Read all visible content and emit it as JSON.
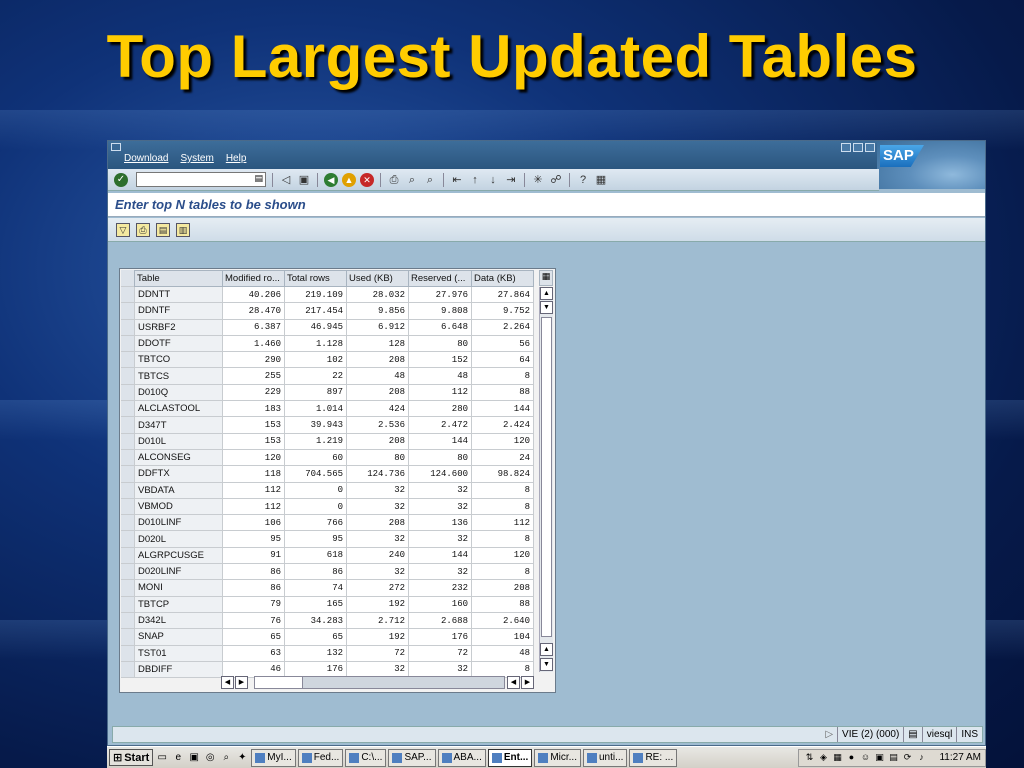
{
  "slide": {
    "title": "Top Largest Updated Tables"
  },
  "menu": {
    "items": [
      "Download",
      "System",
      "Help"
    ]
  },
  "sap": {
    "logo": "SAP"
  },
  "screen": {
    "title": "Enter top N tables to be shown"
  },
  "grid": {
    "columns": [
      "Table",
      "Modified ro...",
      "Total rows",
      "Used (KB)",
      "Reserved (...",
      "Data (KB)"
    ],
    "rows": [
      [
        "DDNTT",
        "40.206",
        "219.109",
        "28.032",
        "27.976",
        "27.864"
      ],
      [
        "DDNTF",
        "28.470",
        "217.454",
        "9.856",
        "9.808",
        "9.752"
      ],
      [
        "USRBF2",
        "6.387",
        "46.945",
        "6.912",
        "6.648",
        "2.264"
      ],
      [
        "DDOTF",
        "1.460",
        "1.128",
        "128",
        "80",
        "56"
      ],
      [
        "TBTCO",
        "290",
        "102",
        "208",
        "152",
        "64"
      ],
      [
        "TBTCS",
        "255",
        "22",
        "48",
        "48",
        "8"
      ],
      [
        "D010Q",
        "229",
        "897",
        "208",
        "112",
        "88"
      ],
      [
        "ALCLASTOOL",
        "183",
        "1.014",
        "424",
        "280",
        "144"
      ],
      [
        "D347T",
        "153",
        "39.943",
        "2.536",
        "2.472",
        "2.424"
      ],
      [
        "D010L",
        "153",
        "1.219",
        "208",
        "144",
        "120"
      ],
      [
        "ALCONSEG",
        "120",
        "60",
        "80",
        "80",
        "24"
      ],
      [
        "DDFTX",
        "118",
        "704.565",
        "124.736",
        "124.600",
        "98.824"
      ],
      [
        "VBDATA",
        "112",
        "0",
        "32",
        "32",
        "8"
      ],
      [
        "VBMOD",
        "112",
        "0",
        "32",
        "32",
        "8"
      ],
      [
        "D010LINF",
        "106",
        "766",
        "208",
        "136",
        "112"
      ],
      [
        "D020L",
        "95",
        "95",
        "32",
        "32",
        "8"
      ],
      [
        "ALGRPCUSGE",
        "91",
        "618",
        "240",
        "144",
        "120"
      ],
      [
        "D020LINF",
        "86",
        "86",
        "32",
        "32",
        "8"
      ],
      [
        "MONI",
        "86",
        "74",
        "272",
        "232",
        "208"
      ],
      [
        "TBTCP",
        "79",
        "165",
        "192",
        "160",
        "88"
      ],
      [
        "D342L",
        "76",
        "34.283",
        "2.712",
        "2.688",
        "2.640"
      ],
      [
        "SNAP",
        "65",
        "65",
        "192",
        "176",
        "104"
      ],
      [
        "TST01",
        "63",
        "132",
        "72",
        "72",
        "48"
      ],
      [
        "DBDIFF",
        "46",
        "176",
        "32",
        "32",
        "8"
      ]
    ]
  },
  "status": {
    "system": "VIE (2) (000)",
    "server": "viesql",
    "mode": "INS"
  },
  "taskbar": {
    "start": "Start",
    "items": [
      "MyI...",
      "Fed...",
      "C:\\...",
      "SAP...",
      "ABA...",
      "Ent...",
      "Micr...",
      "unti...",
      "RE: ..."
    ],
    "active_index": 5,
    "clock": "11:27 AM"
  },
  "colors": {
    "title": "#ffcc00",
    "header_bar": "#2b567f",
    "screen_title": "#2a4d8a"
  }
}
